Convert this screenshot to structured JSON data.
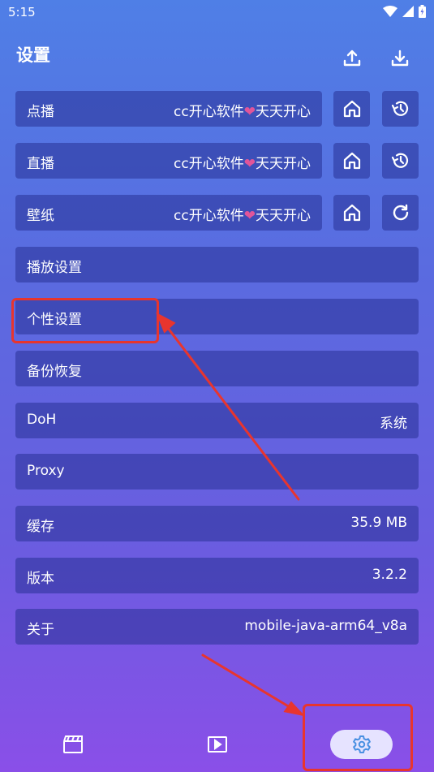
{
  "status_bar": {
    "time": "5:15"
  },
  "header": {
    "title": "设置"
  },
  "source_rows": [
    {
      "label": "点播",
      "value_prefix": "cc开心软件",
      "heart": "❤",
      "value_suffix": "天天开心",
      "action_icon": "history-icon"
    },
    {
      "label": "直播",
      "value_prefix": "cc开心软件",
      "heart": "❤",
      "value_suffix": "天天开心",
      "action_icon": "history-icon"
    },
    {
      "label": "壁纸",
      "value_prefix": "cc开心软件",
      "heart": "❤",
      "value_suffix": "天天开心",
      "action_icon": "refresh-icon"
    }
  ],
  "settings": {
    "playback": {
      "label": "播放设置"
    },
    "personal": {
      "label": "个性设置"
    },
    "backup": {
      "label": "备份恢复"
    },
    "doh": {
      "label": "DoH",
      "value": "系统"
    },
    "proxy": {
      "label": "Proxy"
    },
    "cache": {
      "label": "缓存",
      "value": "35.9 MB"
    },
    "version": {
      "label": "版本",
      "value": "3.2.2"
    },
    "about": {
      "label": "关于",
      "value": "mobile-java-arm64_v8a"
    }
  },
  "colors": {
    "accent": "#4a90e2",
    "annotation": "#e8352e",
    "heart": "#e0559a"
  }
}
